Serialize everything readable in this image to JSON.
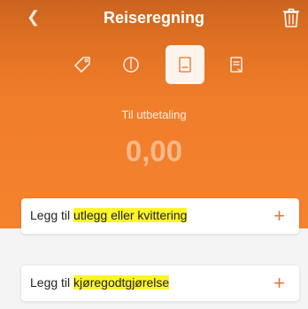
{
  "header": {
    "title": "Reiseregning",
    "back_icon": "chevron-left-icon",
    "trash_icon": "trash-icon"
  },
  "tabs": [
    {
      "icon": "tag-icon",
      "selected": false
    },
    {
      "icon": "compass-icon",
      "selected": false
    },
    {
      "icon": "receipt-icon",
      "selected": true
    },
    {
      "icon": "document-icon",
      "selected": false
    }
  ],
  "summary": {
    "label": "Til utbetaling",
    "amount": "0,00"
  },
  "actions": [
    {
      "prefix": "Legg til ",
      "highlight": "utlegg eller kvittering",
      "plus": "+"
    },
    {
      "prefix": "Legg til ",
      "highlight": "kjøregodtgjørelse",
      "plus": "+"
    }
  ],
  "colors": {
    "accent": "#f5822d",
    "highlight": "#fdf52a",
    "plus": "#e5753a"
  }
}
